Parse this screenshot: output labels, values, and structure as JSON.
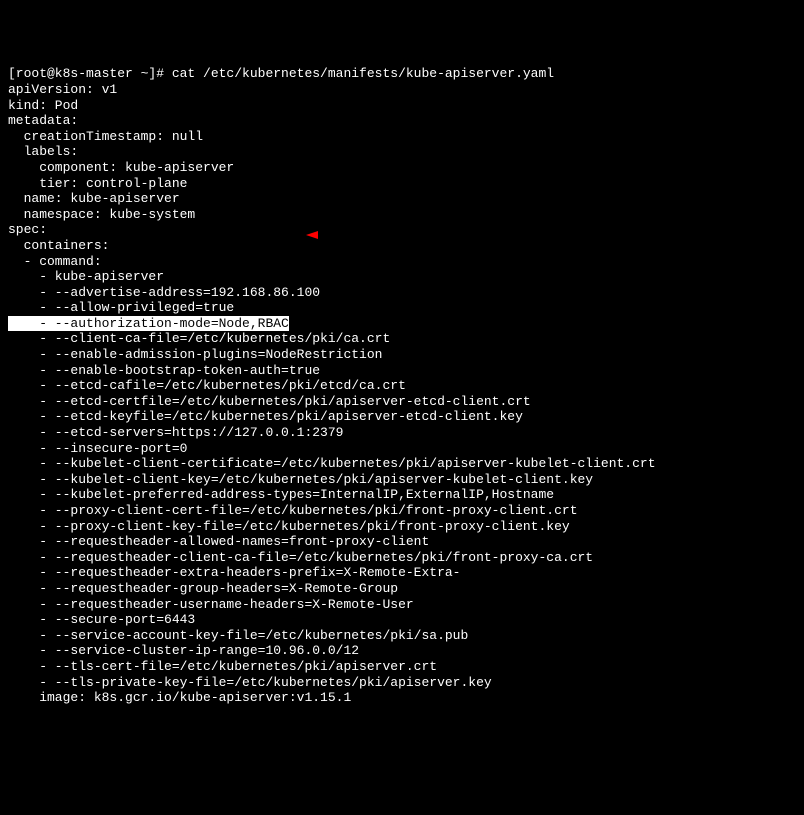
{
  "prompt": "[root@k8s-master ~]# cat /etc/kubernetes/manifests/kube-apiserver.yaml",
  "lines": [
    "apiVersion: v1",
    "kind: Pod",
    "metadata:",
    "  creationTimestamp: null",
    "  labels:",
    "    component: kube-apiserver",
    "    tier: control-plane",
    "  name: kube-apiserver",
    "  namespace: kube-system",
    "spec:",
    "  containers:",
    "  - command:",
    "    - kube-apiserver",
    "    - --advertise-address=192.168.86.100",
    "    - --allow-privileged=true"
  ],
  "highlighted_line": "    - --authorization-mode=Node,RBAC",
  "lines_after": [
    "    - --client-ca-file=/etc/kubernetes/pki/ca.crt",
    "    - --enable-admission-plugins=NodeRestriction",
    "    - --enable-bootstrap-token-auth=true",
    "    - --etcd-cafile=/etc/kubernetes/pki/etcd/ca.crt",
    "    - --etcd-certfile=/etc/kubernetes/pki/apiserver-etcd-client.crt",
    "    - --etcd-keyfile=/etc/kubernetes/pki/apiserver-etcd-client.key",
    "    - --etcd-servers=https://127.0.0.1:2379",
    "    - --insecure-port=0",
    "    - --kubelet-client-certificate=/etc/kubernetes/pki/apiserver-kubelet-client.crt",
    "    - --kubelet-client-key=/etc/kubernetes/pki/apiserver-kubelet-client.key",
    "    - --kubelet-preferred-address-types=InternalIP,ExternalIP,Hostname",
    "    - --proxy-client-cert-file=/etc/kubernetes/pki/front-proxy-client.crt",
    "    - --proxy-client-key-file=/etc/kubernetes/pki/front-proxy-client.key",
    "    - --requestheader-allowed-names=front-proxy-client",
    "    - --requestheader-client-ca-file=/etc/kubernetes/pki/front-proxy-ca.crt",
    "    - --requestheader-extra-headers-prefix=X-Remote-Extra-",
    "    - --requestheader-group-headers=X-Remote-Group",
    "    - --requestheader-username-headers=X-Remote-User",
    "    - --secure-port=6443",
    "    - --service-account-key-file=/etc/kubernetes/pki/sa.pub",
    "    - --service-cluster-ip-range=10.96.0.0/12",
    "    - --tls-cert-file=/etc/kubernetes/pki/apiserver.crt",
    "    - --tls-private-key-file=/etc/kubernetes/pki/apiserver.key",
    "    image: k8s.gcr.io/kube-apiserver:v1.15.1"
  ]
}
